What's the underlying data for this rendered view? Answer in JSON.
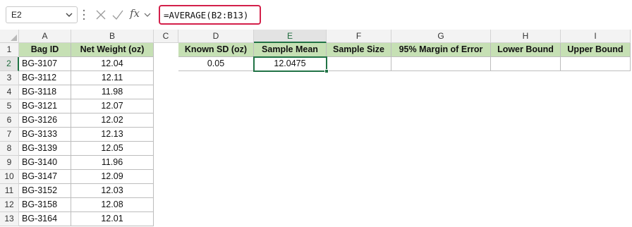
{
  "formula_bar": {
    "name_box": "E2",
    "fx_label": "fx",
    "formula": "=AVERAGE(B2:B13)"
  },
  "columns": [
    "A",
    "B",
    "C",
    "D",
    "E",
    "F",
    "G",
    "H",
    "I"
  ],
  "active_column": "E",
  "rows": [
    "1",
    "2",
    "3",
    "4",
    "5",
    "6",
    "7",
    "8",
    "9",
    "10",
    "11",
    "12",
    "13"
  ],
  "active_row": "2",
  "table": {
    "headers": [
      "Bag ID",
      "Net Weight (oz)"
    ],
    "rows": [
      [
        "BG-3107",
        "12.04"
      ],
      [
        "BG-3112",
        "12.11"
      ],
      [
        "BG-3118",
        "11.98"
      ],
      [
        "BG-3121",
        "12.07"
      ],
      [
        "BG-3126",
        "12.02"
      ],
      [
        "BG-3133",
        "12.13"
      ],
      [
        "BG-3139",
        "12.05"
      ],
      [
        "BG-3140",
        "11.96"
      ],
      [
        "BG-3147",
        "12.09"
      ],
      [
        "BG-3152",
        "12.03"
      ],
      [
        "BG-3158",
        "12.08"
      ],
      [
        "BG-3164",
        "12.01"
      ]
    ]
  },
  "summary": {
    "headers": [
      "Known SD (oz)",
      "Sample Mean",
      "Sample Size",
      "95% Margin of Error",
      "Lower Bound",
      "Upper Bound"
    ],
    "values": [
      "0.05",
      "12.0475",
      "",
      "",
      "",
      ""
    ]
  },
  "colors": {
    "header_fill": "#c6e0b4",
    "selection": "#217346",
    "formula_highlight": "#d3204a"
  },
  "icons": [
    "chevron-down-icon",
    "vertical-dots-icon",
    "cancel-x-icon",
    "enter-check-icon",
    "fx-icon",
    "chevron-down-icon"
  ]
}
